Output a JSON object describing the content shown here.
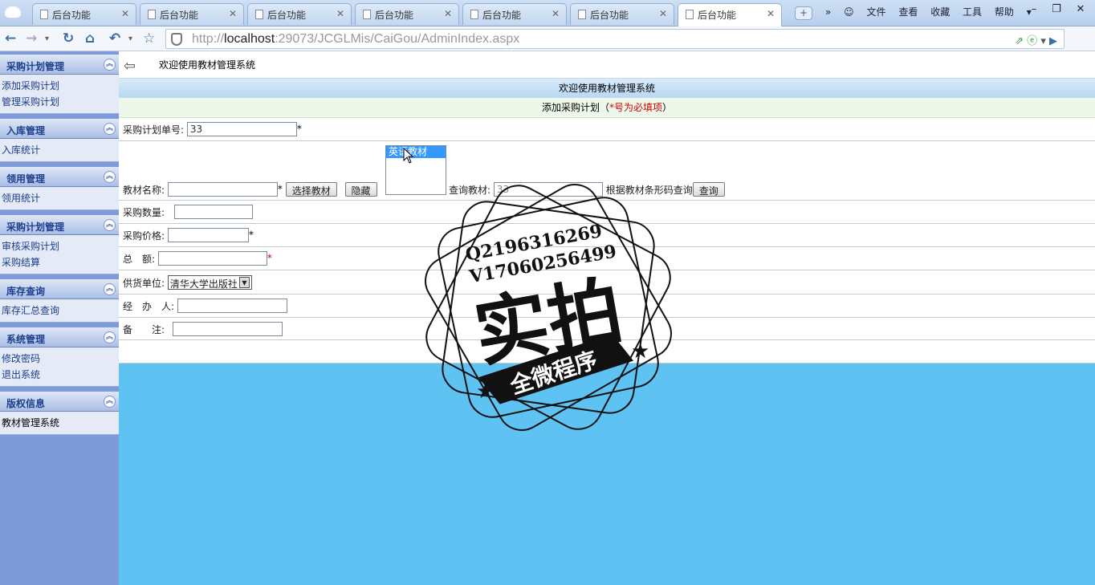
{
  "browser": {
    "tabs": [
      {
        "label": "后台功能"
      },
      {
        "label": "后台功能"
      },
      {
        "label": "后台功能"
      },
      {
        "label": "后台功能"
      },
      {
        "label": "后台功能"
      },
      {
        "label": "后台功能"
      },
      {
        "label": "后台功能"
      }
    ],
    "menu": {
      "file": "文件",
      "view": "查看",
      "favorites": "收藏",
      "tools": "工具",
      "help": "帮助"
    },
    "url_prefix": "http://",
    "url_host": "localhost",
    "url_rest": ":29073/JCGLMis/CaiGou/AdminIndex.aspx"
  },
  "sidebar": {
    "sections": [
      {
        "title": "采购计划管理",
        "items": [
          "添加采购计划",
          "管理采购计划"
        ]
      },
      {
        "title": "入库管理",
        "items": [
          "入库统计"
        ]
      },
      {
        "title": "领用管理",
        "items": [
          "领用统计"
        ]
      },
      {
        "title": "采购计划管理",
        "items": [
          "审核采购计划",
          "采购结算"
        ]
      },
      {
        "title": "库存查询",
        "items": [
          "库存汇总查询"
        ]
      },
      {
        "title": "系统管理",
        "items": [
          "修改密码",
          "退出系统"
        ]
      },
      {
        "title": "版权信息",
        "items": [
          "教材管理系统"
        ]
      }
    ]
  },
  "main": {
    "welcome": "欢迎使用教材管理系统",
    "header": "欢迎使用教材管理系统",
    "subheader_prefix": "添加采购计划（",
    "subheader_red": "*号为必填项",
    "subheader_suffix": "）",
    "form": {
      "plan_no_label": "采购计划单号:",
      "plan_no_value": "33",
      "listbox_option": "英语教材",
      "textbook_label": "教材名称:",
      "select_button": "选择教材",
      "hide_button": "隐藏",
      "query_label": "查询教材:",
      "query_value": "33",
      "barcode_label": "根据教材条形码查询",
      "query_button": "查询",
      "qty_label": "采购数量:",
      "price_label": "采购价格:",
      "total_label": "总　额:",
      "supplier_label": "供货单位:",
      "supplier_value": "清华大学出版社",
      "handler_label": "经　办　人:",
      "remark_label": "备　　注:",
      "star": "*"
    }
  },
  "watermark": {
    "line1": "Q2196316269",
    "line2": "V17060256499",
    "big": "实拍",
    "banner": "全微程序"
  }
}
